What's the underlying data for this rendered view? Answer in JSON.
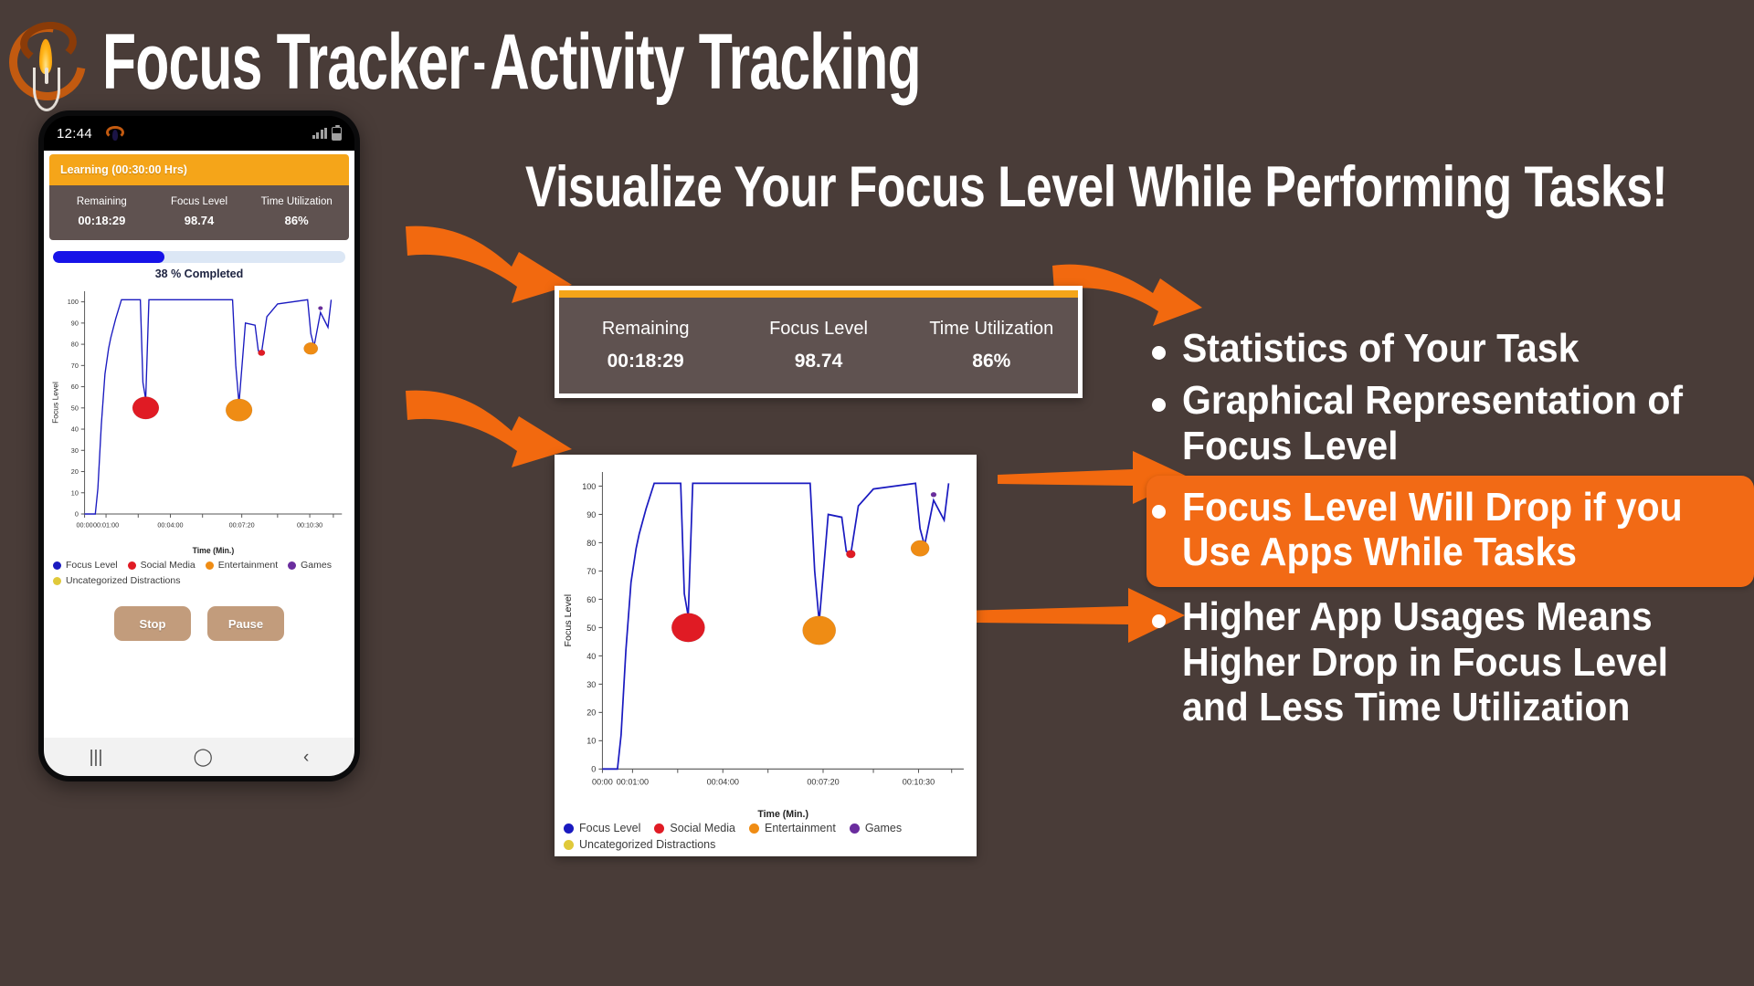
{
  "header": {
    "app_name": "Focus Tracker",
    "separator": "-",
    "subtitle": "Activity Tracking",
    "logo_icon": "candle-flame-icon"
  },
  "headline": "Visualize Your Focus Level While Performing Tasks!",
  "phone": {
    "status_bar": {
      "time": "12:44",
      "app_icon": "candle-flame-icon",
      "signal_icon": "signal-bars-icon",
      "battery_icon": "battery-icon"
    },
    "task_card": {
      "title": "Learning  (00:30:00 Hrs)"
    },
    "stats": [
      {
        "label": "Remaining",
        "value": "00:18:29"
      },
      {
        "label": "Focus Level",
        "value": "98.74"
      },
      {
        "label": "Time Utilization",
        "value": "86%"
      }
    ],
    "progress": {
      "percent": 38,
      "text": "38 % Completed"
    },
    "buttons": [
      {
        "label": "Stop",
        "name": "stop-button"
      },
      {
        "label": "Pause",
        "name": "pause-button"
      }
    ],
    "nav": [
      {
        "icon": "recents-icon",
        "glyph": "|||"
      },
      {
        "icon": "home-icon",
        "glyph": "◯"
      },
      {
        "icon": "back-icon",
        "glyph": "‹"
      }
    ]
  },
  "callout_stats": [
    {
      "label": "Remaining",
      "value": "00:18:29"
    },
    {
      "label": "Focus Level",
      "value": "98.74"
    },
    {
      "label": "Time Utilization",
      "value": "86%"
    }
  ],
  "bullets": [
    {
      "text": "Statistics of Your Task",
      "highlighted": false
    },
    {
      "text": "Graphical Representation of Focus Level",
      "highlighted": false
    },
    {
      "text": "Focus Level Will Drop if you Use Apps While Tasks",
      "highlighted": true
    },
    {
      "text": "Higher App Usages Means Higher Drop in Focus Level and Less Time Utilization",
      "highlighted": false
    }
  ],
  "colors": {
    "background": "#493c38",
    "accent_orange": "#f26a15",
    "amber": "#f5a519",
    "panel": "#5f5250",
    "focus_line": "#1a1ac0",
    "social_media": "#e01b24",
    "entertainment": "#ef8c14",
    "games": "#6a2d9e",
    "uncategorized": "#e0c93a",
    "progress_fill": "#1713e8"
  },
  "chart_data": {
    "type": "line",
    "title": "",
    "xlabel": "Time (Min.)",
    "ylabel": "Focus Level",
    "xlim": [
      0,
      12
    ],
    "ylim": [
      0,
      105
    ],
    "yticks": [
      0,
      10,
      20,
      30,
      40,
      50,
      60,
      70,
      80,
      90,
      100
    ],
    "xticks": [
      0,
      1,
      4,
      7.33,
      10.5
    ],
    "xticklabels": [
      "00:00",
      "00:01:00",
      "00:04:00",
      "00:07:20",
      "00:10:30"
    ],
    "grid": false,
    "legend_position": "bottom",
    "series": [
      {
        "name": "Focus Level",
        "color": "#1a1ac0",
        "x": [
          0.0,
          0.5,
          0.62,
          0.78,
          0.95,
          1.12,
          1.22,
          1.45,
          1.72,
          2.6,
          2.72,
          2.85,
          3.0,
          3.9,
          4.0,
          6.9,
          7.05,
          7.2,
          7.5,
          7.95,
          8.1,
          8.25,
          8.5,
          9.0,
          10.4,
          10.55,
          10.7,
          11.0,
          11.35,
          11.5
        ],
        "y": [
          0,
          0,
          12,
          42,
          66,
          78,
          83,
          92,
          101,
          101,
          62,
          54,
          101,
          101,
          101,
          101,
          70,
          52,
          90,
          89,
          77,
          76,
          93,
          99,
          101,
          85,
          79,
          95,
          88,
          101
        ]
      }
    ],
    "markers": [
      {
        "label": "Social Media",
        "color": "#e01b24",
        "x": 2.85,
        "y": 50,
        "size": "large"
      },
      {
        "label": "Entertainment",
        "color": "#ef8c14",
        "x": 7.2,
        "y": 49,
        "size": "large"
      },
      {
        "label": "Social Media",
        "color": "#e01b24",
        "x": 8.25,
        "y": 76,
        "size": "small"
      },
      {
        "label": "Entertainment",
        "color": "#ef8c14",
        "x": 10.55,
        "y": 78,
        "size": "medium"
      },
      {
        "label": "Games",
        "color": "#6a2d9e",
        "x": 11.0,
        "y": 97,
        "size": "tiny"
      }
    ],
    "legend": [
      {
        "label": "Focus Level",
        "color": "#1a1ac0"
      },
      {
        "label": "Social Media",
        "color": "#e01b24"
      },
      {
        "label": "Entertainment",
        "color": "#ef8c14"
      },
      {
        "label": "Games",
        "color": "#6a2d9e"
      },
      {
        "label": "Uncategorized Distractions",
        "color": "#e0c93a"
      }
    ]
  }
}
